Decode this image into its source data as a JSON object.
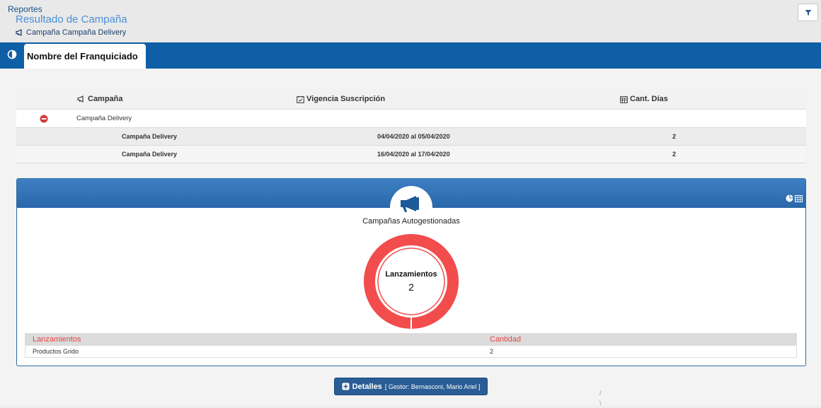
{
  "header": {
    "breadcrumb_root": "Reportes",
    "title": "Resultado de Campaña",
    "subtitle": "Campaña Campaña Delivery"
  },
  "tab": {
    "label": "Nombre del Franquiciado"
  },
  "table": {
    "columns": [
      "Campaña",
      "Vigencia Suscripción",
      "Cant. Días"
    ],
    "group": {
      "name": "Campaña Delivery"
    },
    "rows": [
      {
        "campaign": "Campaña Delivery",
        "period": "04/04/2020 al 05/04/2020",
        "days": "2"
      },
      {
        "campaign": "Campaña Delivery",
        "period": "16/04/2020 al 17/04/2020",
        "days": "2"
      }
    ]
  },
  "panel": {
    "title": "Campañas Autogestionadas",
    "center_label": "Lanzamientos",
    "center_value": "2",
    "legend_headers": [
      "Lanzamientos",
      "Cantidad"
    ],
    "legend_rows": [
      {
        "name": "Productos Grido",
        "qty": "2"
      }
    ]
  },
  "chart_data": {
    "type": "pie",
    "title": "Campañas Autogestionadas",
    "categories": [
      "Productos Grido"
    ],
    "values": [
      2
    ],
    "colors": [
      "#f24c4c"
    ]
  },
  "button": {
    "label": "Detalles",
    "gestor": "[ Gestor: Bernasconi, Mario Ariel ]"
  },
  "colors": {
    "primary_bar": "#0e5fa6",
    "panel_head": "#2a67ab",
    "donut": "#f24c4c",
    "accent_red": "#e64545"
  }
}
